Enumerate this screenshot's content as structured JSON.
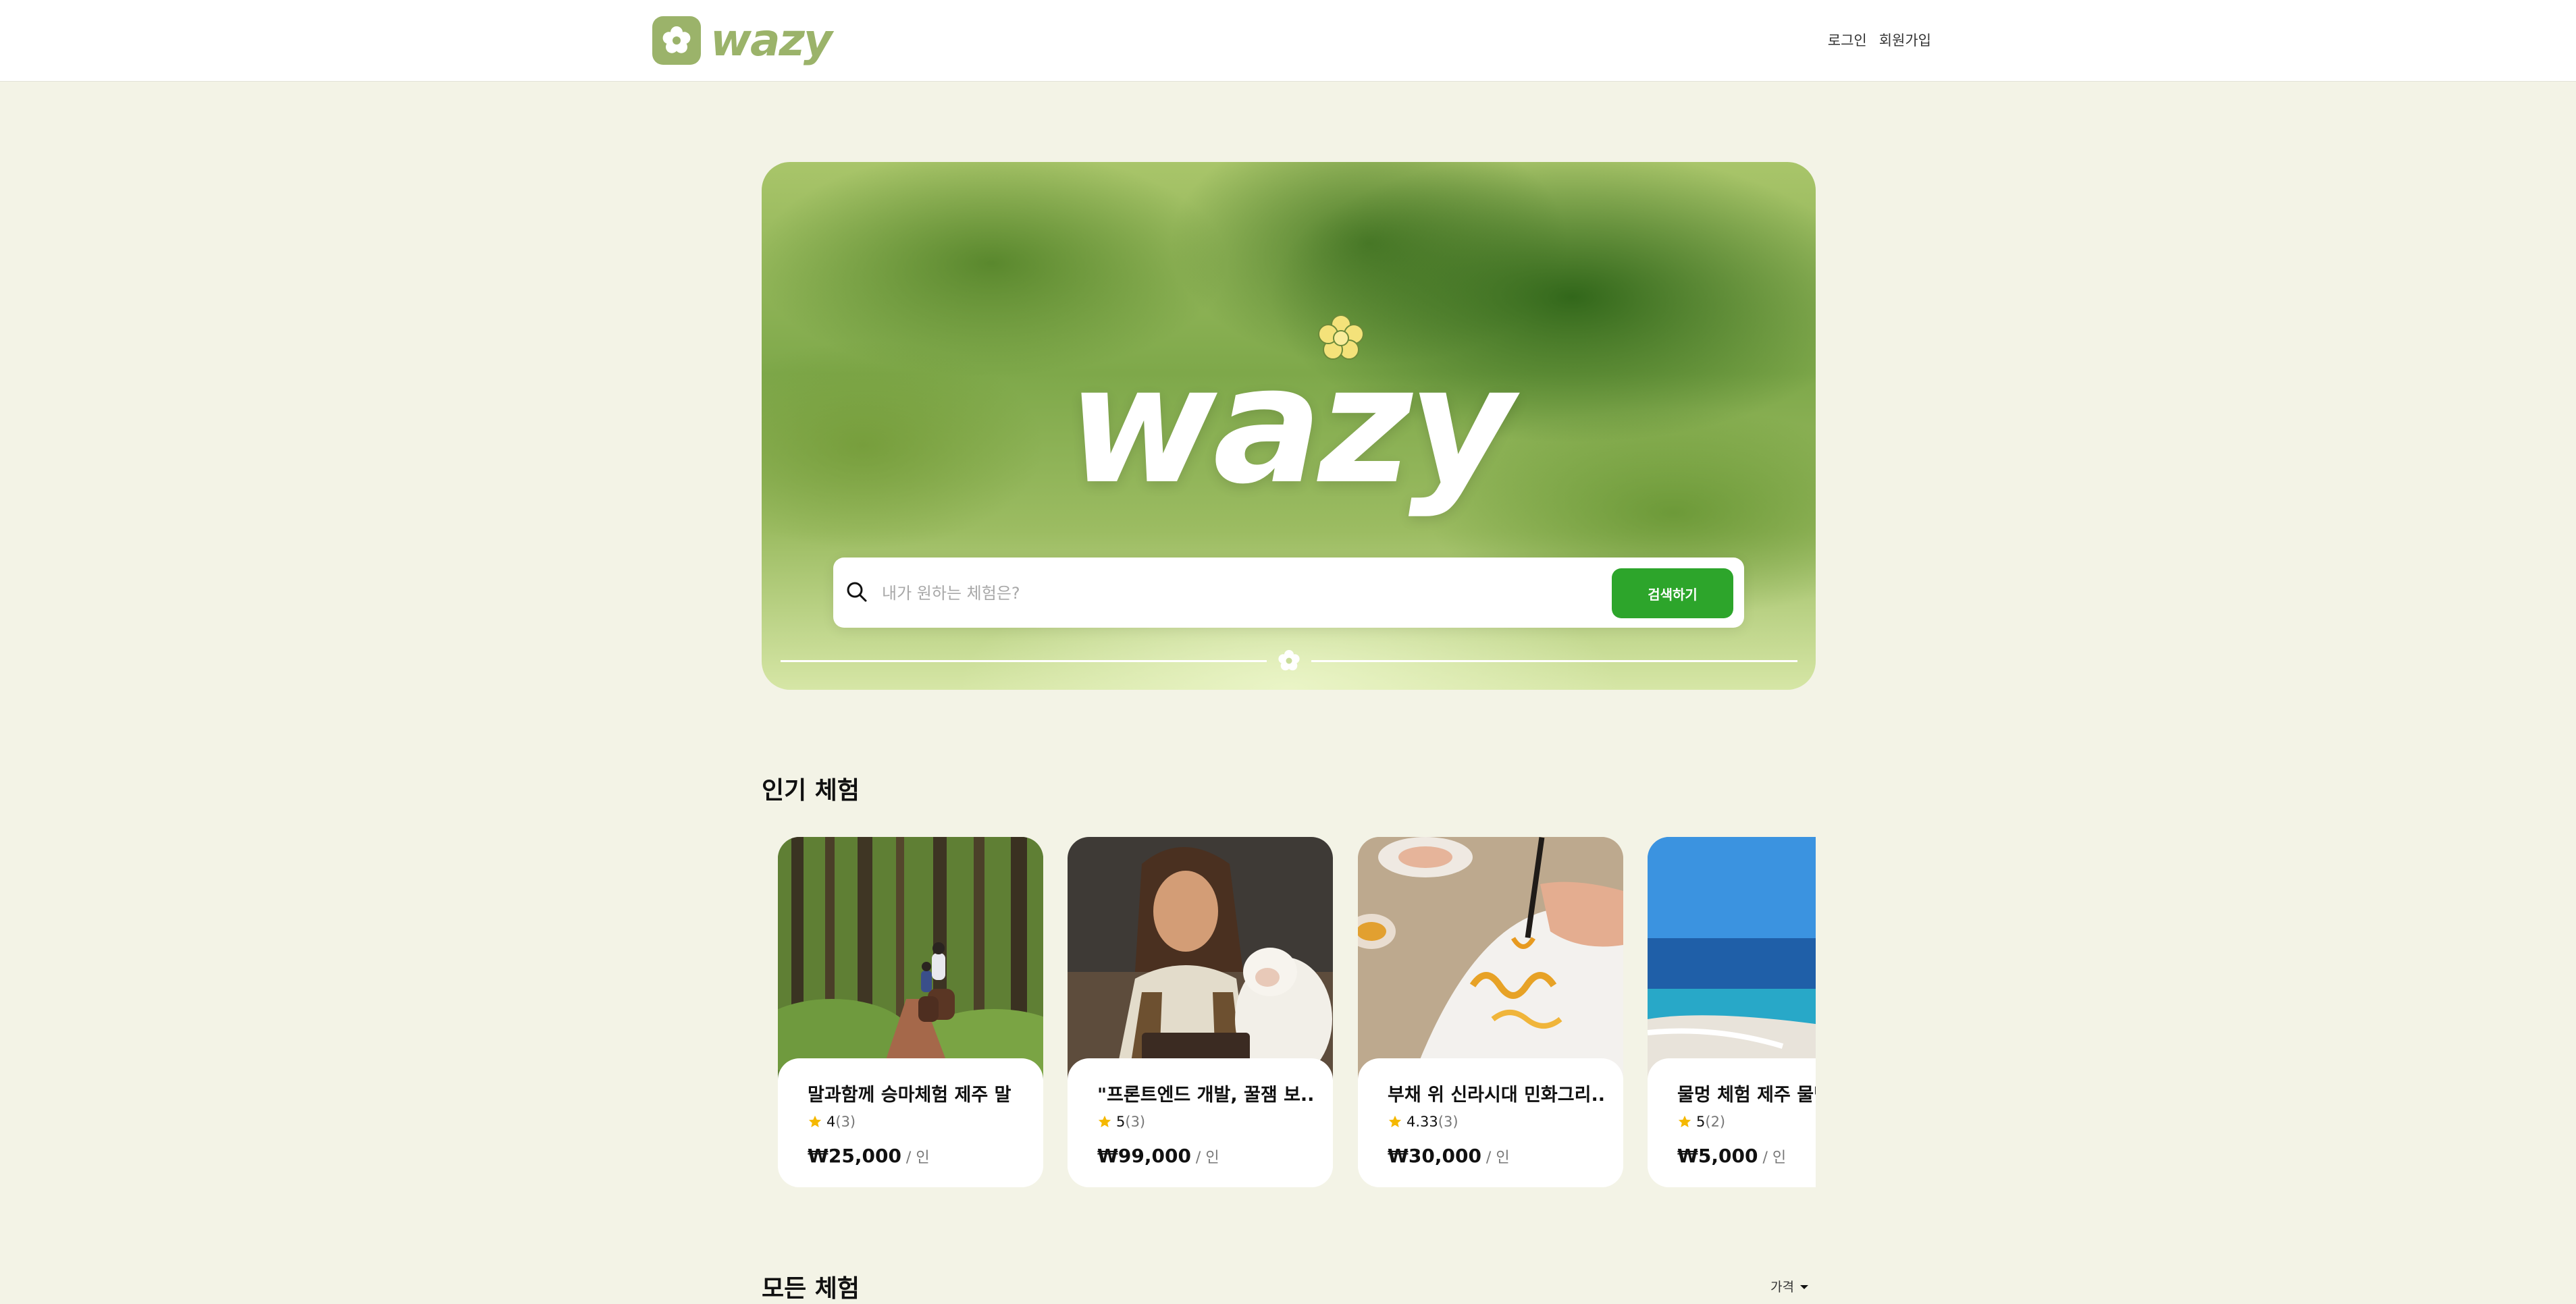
{
  "header": {
    "logo_text": "wazy",
    "login_label": "로그인",
    "signup_label": "회원가입"
  },
  "hero": {
    "brand_text": "wazy",
    "search_placeholder": "내가 원하는 체험은?",
    "search_button_label": "검색하기"
  },
  "popular": {
    "title": "인기 체험",
    "cards": [
      {
        "title": "말과함께 승마체험 제주 말",
        "rating": "4",
        "review_count": "(3)",
        "price": "₩25,000",
        "unit": " / 인"
      },
      {
        "title": "\"프론트엔드 개발, 꿀잼 보...",
        "rating": "5",
        "review_count": "(3)",
        "price": "₩99,000",
        "unit": " / 인"
      },
      {
        "title": "부채 위 신라시대 민화그리...",
        "rating": "4.33",
        "review_count": "(3)",
        "price": "₩30,000",
        "unit": " / 인"
      },
      {
        "title": "물멍 체험 제주 물멍",
        "rating": "5",
        "review_count": "(2)",
        "price": "₩5,000",
        "unit": " / 인"
      }
    ]
  },
  "all": {
    "title": "모든 체험",
    "sort_label": "가격"
  },
  "colors": {
    "brand": "#9bb36a",
    "accent_button": "#2da52b",
    "background": "#f3f3e6",
    "star": "#f5b800"
  }
}
